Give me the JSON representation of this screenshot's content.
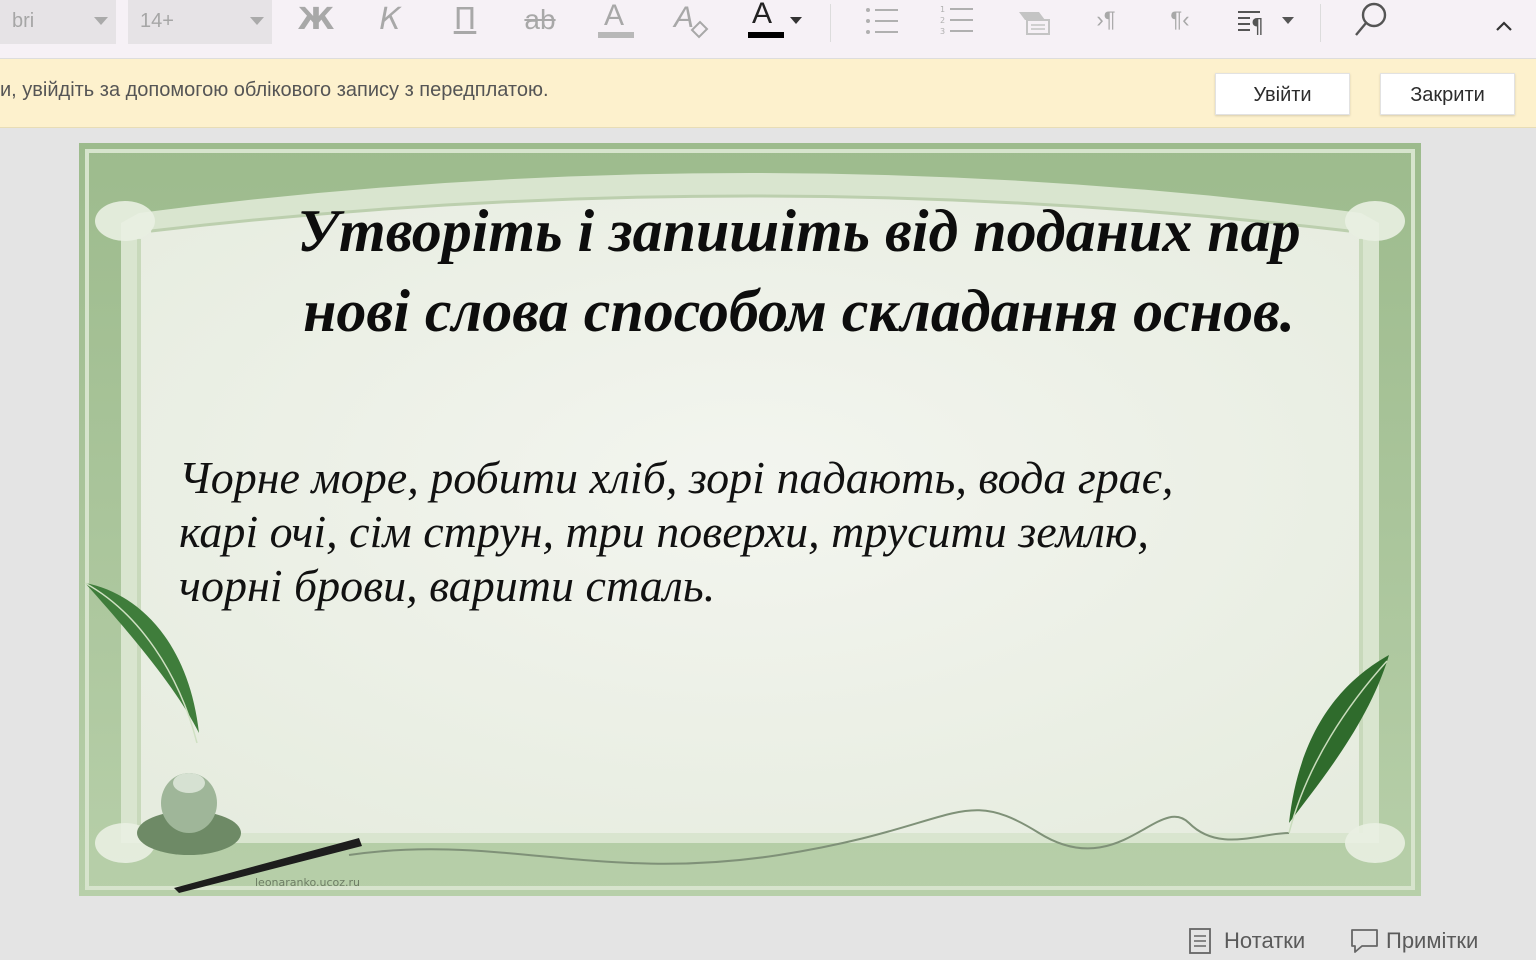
{
  "toolbar": {
    "font_name": "bri",
    "font_size": "14+",
    "bold_glyph": "Ж",
    "italic_glyph": "К",
    "underline_glyph": "П",
    "strike_glyph": "ab",
    "font_color_glyph": "A",
    "clear_glyph": "A",
    "text_color_glyph": "A",
    "text_color_value": "#000000",
    "ltr_glyph": "›¶",
    "rtl_glyph": "¶‹",
    "icons": [
      "bold-icon",
      "italic-icon",
      "underline-icon",
      "strikethrough-icon",
      "font-color-icon",
      "clear-format-icon",
      "text-color-icon",
      "bullet-list-icon",
      "numbered-list-icon",
      "decrease-indent-icon",
      "ltr-icon",
      "rtl-icon",
      "paragraph-icon",
      "search-icon",
      "collapse-icon"
    ]
  },
  "notice": {
    "text": "и, увійдіть за допомогою облікового запису з передплатою.",
    "signin_label": "Увійти",
    "close_label": "Закрити",
    "background": "#fdf1cd"
  },
  "slide": {
    "title_line1": "Утворіть і запишіть від поданих пар",
    "title_line2": "нові слова способом складання основ.",
    "body_line1": "Чорне море, робити хліб, зорі падають, вода грає,",
    "body_line2": "карі очі, сім струн, три поверхи, трусити землю,",
    "body_line3": "чорні брови, варити сталь.",
    "credit": "leonaranko.ucoz.ru",
    "frame_color": "#a9c59a",
    "paper_color": "#eef1e9"
  },
  "statusbar": {
    "notes_label": "Нотатки",
    "comments_label": "Примітки"
  }
}
